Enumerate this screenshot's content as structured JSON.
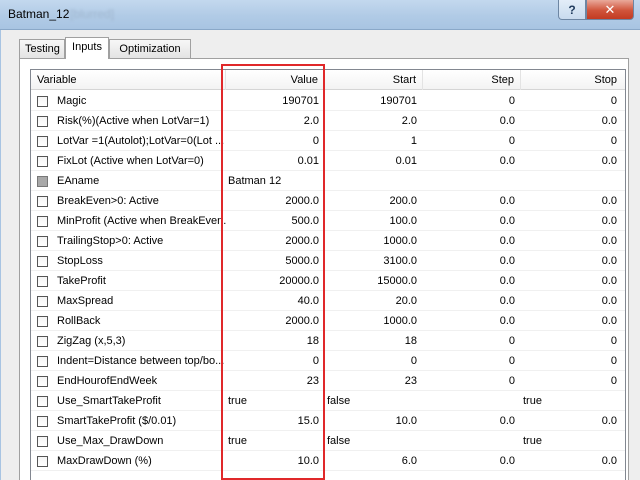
{
  "window": {
    "title": "Batman_12",
    "bg_title": "[blurred]",
    "help_glyph": "?",
    "close_glyph": "✕"
  },
  "tabs": [
    {
      "label": "Testing"
    },
    {
      "label": "Inputs",
      "active": true
    },
    {
      "label": "Optimization"
    }
  ],
  "columns": {
    "variable": "Variable",
    "value": "Value",
    "start": "Start",
    "step": "Step",
    "stop": "Stop"
  },
  "rows": [
    {
      "variable": "Magic",
      "value": "190701",
      "start": "190701",
      "step": "0",
      "stop": "0"
    },
    {
      "variable": "Risk(%)(Active when LotVar=1)",
      "value": "2.0",
      "start": "2.0",
      "step": "0.0",
      "stop": "0.0"
    },
    {
      "variable": "LotVar =1(Autolot);LotVar=0(Lot ...",
      "value": "0",
      "start": "1",
      "step": "0",
      "stop": "0"
    },
    {
      "variable": "FixLot (Active when LotVar=0)",
      "value": "0.01",
      "start": "0.01",
      "step": "0.0",
      "stop": "0.0"
    },
    {
      "variable": "EAname",
      "value": "Batman 12",
      "start": "",
      "step": "",
      "stop": "",
      "text": true,
      "disabled": true
    },
    {
      "variable": "BreakEven>0: Active",
      "value": "2000.0",
      "start": "200.0",
      "step": "0.0",
      "stop": "0.0"
    },
    {
      "variable": "MinProfit (Active when BreakEven...",
      "value": "500.0",
      "start": "100.0",
      "step": "0.0",
      "stop": "0.0"
    },
    {
      "variable": "TrailingStop>0: Active",
      "value": "2000.0",
      "start": "1000.0",
      "step": "0.0",
      "stop": "0.0"
    },
    {
      "variable": "StopLoss",
      "value": "5000.0",
      "start": "3100.0",
      "step": "0.0",
      "stop": "0.0"
    },
    {
      "variable": "TakeProfit",
      "value": "20000.0",
      "start": "15000.0",
      "step": "0.0",
      "stop": "0.0"
    },
    {
      "variable": "MaxSpread",
      "value": "40.0",
      "start": "20.0",
      "step": "0.0",
      "stop": "0.0"
    },
    {
      "variable": "RollBack",
      "value": "2000.0",
      "start": "1000.0",
      "step": "0.0",
      "stop": "0.0"
    },
    {
      "variable": "ZigZag (x,5,3)",
      "value": "18",
      "start": "18",
      "step": "0",
      "stop": "0"
    },
    {
      "variable": "Indent=Distance between top/bo...",
      "value": "0",
      "start": "0",
      "step": "0",
      "stop": "0"
    },
    {
      "variable": "EndHourofEndWeek",
      "value": "23",
      "start": "23",
      "step": "0",
      "stop": "0"
    },
    {
      "variable": "Use_SmartTakeProfit",
      "value": "true",
      "start": "false",
      "step": "",
      "stop": "true",
      "bool": true
    },
    {
      "variable": "SmartTakeProfit ($/0.01)",
      "value": "15.0",
      "start": "10.0",
      "step": "0.0",
      "stop": "0.0"
    },
    {
      "variable": "Use_Max_DrawDown",
      "value": "true",
      "start": "false",
      "step": "",
      "stop": "true",
      "bool": true
    },
    {
      "variable": "MaxDrawDown (%)",
      "value": "10.0",
      "start": "6.0",
      "step": "0.0",
      "stop": "0.0"
    }
  ],
  "colors": {
    "highlight": "#e0282a",
    "titlebar": "#b1cbe6",
    "close": "#c23a22"
  }
}
